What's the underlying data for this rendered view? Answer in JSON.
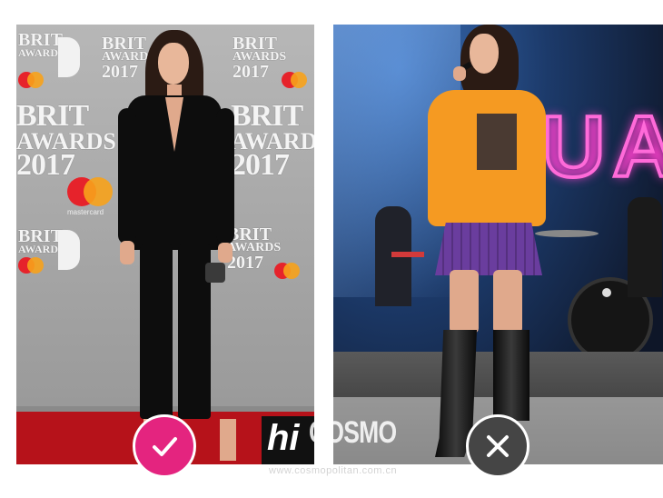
{
  "left_photo": {
    "backdrop_text": [
      "BRIT",
      "AWARDS",
      "2017"
    ],
    "sponsor_text": "mastercard"
  },
  "right_photo": {
    "neon_sign": "UA"
  },
  "watermark": {
    "brand_prefix": "hi",
    "brand_name": "COSMO",
    "url": "www.cosmopolitan.com.cn"
  },
  "verdict": {
    "left": "check-icon",
    "right": "cross-icon"
  },
  "colors": {
    "check_badge": "#e4247f",
    "cross_badge": "#454545",
    "carpet": "#b6121a",
    "sweatshirt": "#f59a22",
    "skirt": "#6a3d9e",
    "neon": "#ff6ad9"
  }
}
